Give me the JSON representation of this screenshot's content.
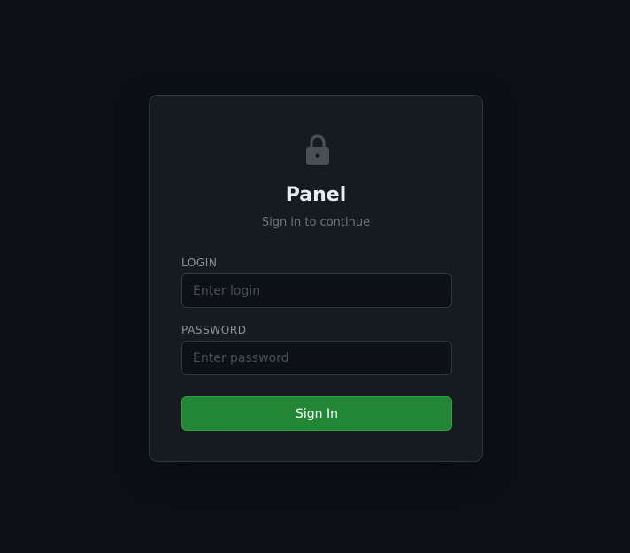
{
  "app": {
    "title": "Panel",
    "subtitle": "Sign in to continue"
  },
  "form": {
    "login": {
      "label": "LOGIN",
      "value": "",
      "placeholder": "Enter login"
    },
    "password": {
      "label": "PASSWORD",
      "value": "",
      "placeholder": "Enter password"
    },
    "submit_label": "Sign In"
  },
  "icons": {
    "header": "lock-icon"
  },
  "colors": {
    "background": "#0d1117",
    "card": "#161b22",
    "border": "#30363d",
    "primary_button": "#238636",
    "title_text": "#e6edf3",
    "muted_text": "#6e7681",
    "label_text": "#8b949e"
  }
}
